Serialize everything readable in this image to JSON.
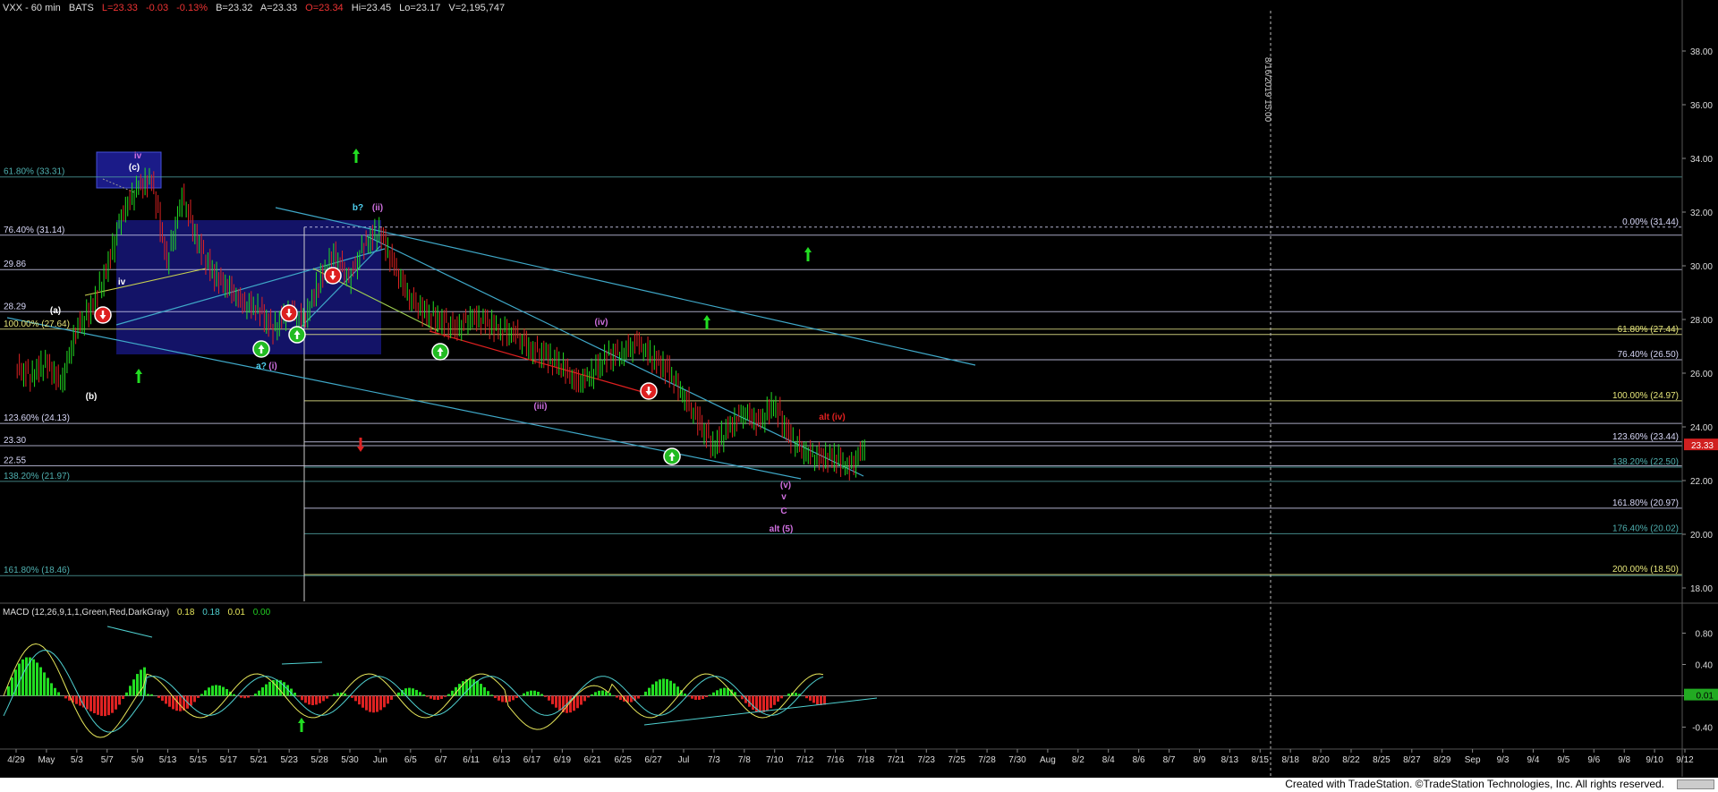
{
  "header": {
    "symbol": "VXX - 60 min",
    "exchange": "BATS",
    "last": "L=23.33",
    "change": "-0.03",
    "change_pct": "-0.13%",
    "bid": "B=23.32",
    "ask": "A=23.33",
    "open": "O=23.34",
    "high": "Hi=23.45",
    "low": "Lo=23.17",
    "volume": "V=2,195,747"
  },
  "macd_header": {
    "title": "MACD (12,26,9,1,1,Green,Red,DarkGray)",
    "v1": "0.18",
    "v2": "0.18",
    "v3": "0.01",
    "v4": "0.00"
  },
  "footer": "Created with TradeStation. ©TradeStation Technologies, Inc. All rights reserved.",
  "vertical_marker": "8/16/2019 15:00",
  "colors": {
    "background": "#000000",
    "up_candle": "#22dd22",
    "down_candle": "#dd2222",
    "price_badge": "#e02020",
    "hline_white": "#d0d0f0",
    "hline_yellow": "#e6e68a",
    "hline_teal": "#4fa0a0",
    "channel": "#3fa8c8",
    "purple_label": "#d070e0"
  },
  "chart_data": {
    "type": "line",
    "title": "",
    "price_axis": {
      "ticks": [
        "38.00",
        "36.00",
        "34.00",
        "32.00",
        "30.00",
        "28.00",
        "26.00",
        "24.00",
        "22.00",
        "20.00",
        "18.00"
      ],
      "ylim": [
        17.5,
        39.5
      ],
      "last_price": "23.33"
    },
    "macd_axis": {
      "ticks": [
        "0.80",
        "0.40",
        "0.00",
        "-0.40"
      ],
      "last_value": "0.01"
    },
    "x_tick_labels": [
      "4/29",
      "May",
      "5/3",
      "5/7",
      "5/9",
      "5/13",
      "5/15",
      "5/17",
      "5/21",
      "5/23",
      "5/28",
      "5/30",
      "Jun",
      "6/5",
      "6/7",
      "6/11",
      "6/13",
      "6/17",
      "6/19",
      "6/21",
      "6/25",
      "6/27",
      "Jul",
      "7/3",
      "7/8",
      "7/10",
      "7/12",
      "7/16",
      "7/18",
      "7/21",
      "7/23",
      "7/25",
      "7/28",
      "7/30",
      "Aug",
      "8/2",
      "8/4",
      "8/6",
      "8/7",
      "8/9",
      "8/13",
      "8/15",
      "8/18",
      "8/20",
      "8/22",
      "8/25",
      "8/27",
      "8/29",
      "Sep",
      "9/3",
      "9/4",
      "9/5",
      "9/6",
      "9/8",
      "9/10",
      "9/12"
    ],
    "left_levels": [
      {
        "label": "61.80% (33.31)",
        "value": 33.31
      },
      {
        "label": "76.40% (31.14)",
        "value": 31.14
      },
      {
        "label": "29.86",
        "value": 29.86
      },
      {
        "label": "28.29",
        "value": 28.29
      },
      {
        "label": "100.00% (27.64)",
        "value": 27.64
      },
      {
        "label": "123.60% (24.13)",
        "value": 24.13
      },
      {
        "label": "23.30",
        "value": 23.3
      },
      {
        "label": "22.55",
        "value": 22.55
      },
      {
        "label": "138.20% (21.97)",
        "value": 21.97
      },
      {
        "label": "161.80% (18.46)",
        "value": 18.46
      }
    ],
    "right_levels": [
      {
        "label": "0.00% (31.44)",
        "value": 31.44
      },
      {
        "label": "61.80% (27.44)",
        "value": 27.44
      },
      {
        "label": "76.40% (26.50)",
        "value": 26.5
      },
      {
        "label": "100.00% (24.97)",
        "value": 24.97
      },
      {
        "label": "123.60% (23.44)",
        "value": 23.44
      },
      {
        "label": "138.20% (22.50)",
        "value": 22.5
      },
      {
        "label": "161.80% (20.97)",
        "value": 20.97
      },
      {
        "label": "176.40% (20.02)",
        "value": 20.02
      },
      {
        "label": "200.00% (18.50)",
        "value": 18.5
      }
    ],
    "price_series": [
      [
        "4/29",
        26.2
      ],
      [
        "4/30",
        25.9
      ],
      [
        "5/1",
        26.4
      ],
      [
        "5/2",
        25.6
      ],
      [
        "5/3",
        27.6
      ],
      [
        "5/6",
        28.4
      ],
      [
        "5/7",
        29.8
      ],
      [
        "5/8",
        31.9
      ],
      [
        "5/9",
        32.9
      ],
      [
        "5/10",
        33.2
      ],
      [
        "5/13",
        30.1
      ],
      [
        "5/14",
        32.6
      ],
      [
        "5/15",
        30.9
      ],
      [
        "5/16",
        29.7
      ],
      [
        "5/17",
        29.2
      ],
      [
        "5/20",
        28.6
      ],
      [
        "5/21",
        28.4
      ],
      [
        "5/22",
        27.6
      ],
      [
        "5/23",
        28.4
      ],
      [
        "5/24",
        27.9
      ],
      [
        "5/28",
        29.4
      ],
      [
        "5/29",
        30.4
      ],
      [
        "5/30",
        29.5
      ],
      [
        "5/31",
        30.8
      ],
      [
        "6/3",
        31.3
      ],
      [
        "6/4",
        29.9
      ],
      [
        "6/5",
        28.8
      ],
      [
        "6/6",
        28.2
      ],
      [
        "6/7",
        28.0
      ],
      [
        "6/10",
        27.6
      ],
      [
        "6/11",
        28.1
      ],
      [
        "6/12",
        27.9
      ],
      [
        "6/13",
        27.6
      ],
      [
        "6/14",
        27.4
      ],
      [
        "6/17",
        26.9
      ],
      [
        "6/18",
        26.6
      ],
      [
        "6/19",
        26.3
      ],
      [
        "6/20",
        25.6
      ],
      [
        "6/21",
        26.0
      ],
      [
        "6/24",
        26.6
      ],
      [
        "6/25",
        26.8
      ],
      [
        "6/26",
        27.1
      ],
      [
        "6/27",
        26.6
      ],
      [
        "6/28",
        26.1
      ],
      [
        "7/1",
        25.2
      ],
      [
        "7/2",
        24.2
      ],
      [
        "7/3",
        23.3
      ],
      [
        "7/5",
        23.9
      ],
      [
        "7/8",
        24.6
      ],
      [
        "7/9",
        24.1
      ],
      [
        "7/10",
        24.9
      ],
      [
        "7/11",
        23.6
      ],
      [
        "7/12",
        23.1
      ],
      [
        "7/15",
        22.8
      ],
      [
        "7/16",
        22.9
      ],
      [
        "7/17",
        22.4
      ],
      [
        "7/18",
        23.33
      ]
    ],
    "wave_labels": [
      {
        "text": "iv",
        "color": "purple"
      },
      {
        "text": "(c)",
        "color": "white"
      },
      {
        "text": "iv",
        "color": "white"
      },
      {
        "text": "(a)",
        "color": "white"
      },
      {
        "text": "(b)",
        "color": "white"
      },
      {
        "text": "a?",
        "color": "teal"
      },
      {
        "text": "(i)",
        "color": "purple"
      },
      {
        "text": "b?",
        "color": "teal"
      },
      {
        "text": "(ii)",
        "color": "purple"
      },
      {
        "text": "(iii)",
        "color": "purple"
      },
      {
        "text": "(iv)",
        "color": "purple"
      },
      {
        "text": "(v)",
        "color": "purple"
      },
      {
        "text": "v",
        "color": "purple"
      },
      {
        "text": "C",
        "color": "purple"
      },
      {
        "text": "alt (5)",
        "color": "purple"
      },
      {
        "text": "alt (iv)",
        "color": "red"
      }
    ],
    "grid": false,
    "legend": "none"
  }
}
